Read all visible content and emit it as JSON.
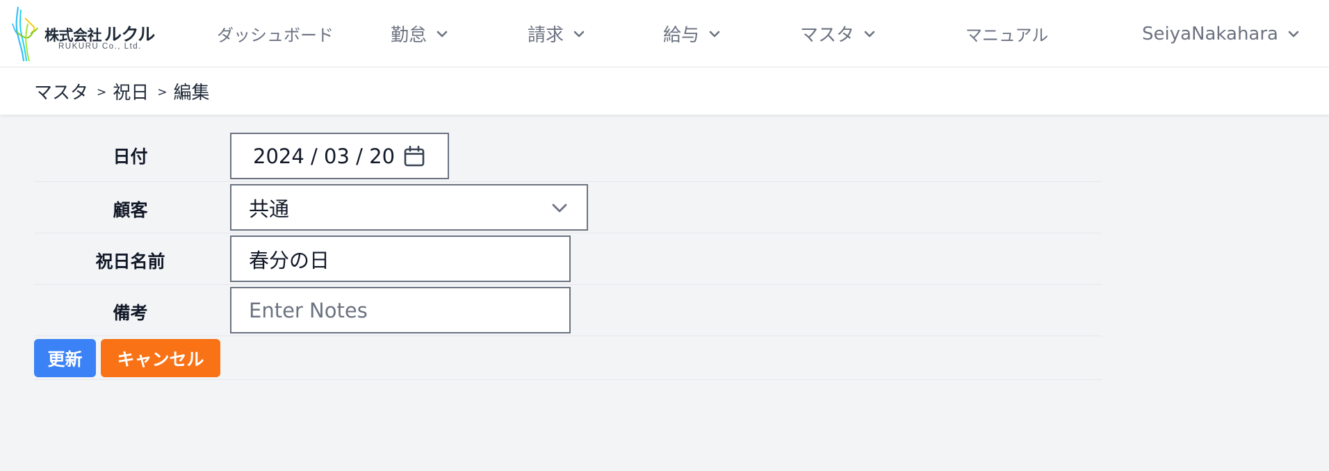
{
  "brand": {
    "name_prefix": "株式会社",
    "name_main": "ルクル",
    "name_en": "RUKURU Co., Ltd."
  },
  "nav": {
    "dashboard": "ダッシュボード",
    "attendance": "勤怠",
    "billing": "請求",
    "payroll": "給与",
    "master": "マスタ",
    "manual": "マニュアル",
    "user": "SeiyaNakahara"
  },
  "breadcrumb": {
    "items": [
      "マスタ",
      "祝日",
      "編集"
    ],
    "separator": ">"
  },
  "form": {
    "date": {
      "label": "日付",
      "value": "2024 / 03 / 20"
    },
    "customer": {
      "label": "顧客",
      "value": "共通"
    },
    "holiday_name": {
      "label": "祝日名前",
      "value": "春分の日"
    },
    "notes": {
      "label": "備考",
      "value": "",
      "placeholder": "Enter Notes"
    }
  },
  "buttons": {
    "update": "更新",
    "cancel": "キャンセル"
  },
  "colors": {
    "update_button": "#3b82f6",
    "cancel_button": "#f97316",
    "background": "#f3f4f6",
    "nav_text": "#6b7280"
  },
  "icons": {
    "logo": "hands-logo-icon",
    "calendar": "calendar-icon",
    "dropdown": "chevron-down-icon"
  }
}
